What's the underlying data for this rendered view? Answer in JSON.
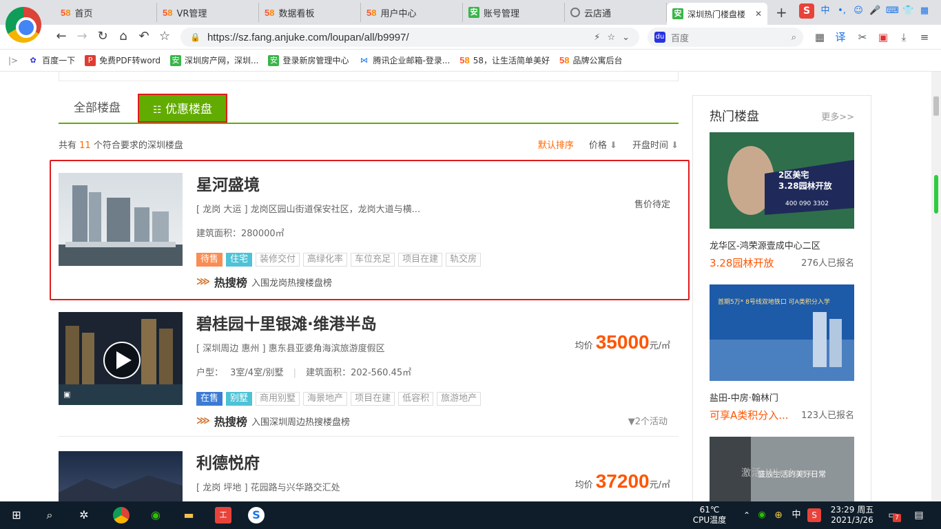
{
  "browser": {
    "tabs": [
      {
        "label": "首页",
        "icon": "58-icon"
      },
      {
        "label": "VR管理",
        "icon": "58-icon"
      },
      {
        "label": "数据看板",
        "icon": "58-icon"
      },
      {
        "label": "用户中心",
        "icon": "58-icon"
      },
      {
        "label": "账号管理",
        "icon": "anjuke-icon"
      },
      {
        "label": "云店通",
        "icon": "globe-icon"
      },
      {
        "label": "深圳热门楼盘楼",
        "icon": "anjuke-icon"
      }
    ],
    "url": "https://sz.fang.anjuke.com/loupan/all/b9997/",
    "search_placeholder": "百度",
    "bookmarks": [
      "百度一下",
      "免费PDF转word",
      "深圳房产网，深圳...",
      "登录新房管理中心",
      "腾讯企业邮箱-登录...",
      "58，让生活简单美好",
      "品牌公寓后台"
    ]
  },
  "page": {
    "tabs": {
      "all": "全部楼盘",
      "promo": "优惠楼盘"
    },
    "result": {
      "prefix": "共有",
      "count": "11",
      "suffix": "个符合要求的深圳楼盘"
    },
    "sorts": {
      "default": "默认排序",
      "price": "价格",
      "open_time": "开盘时间"
    },
    "listings": [
      {
        "name": "星河盛境",
        "address": "[ 龙岗 大运 ] 龙岗区园山街道保安社区，龙岗大道与横...",
        "attr": "建筑面积：280000㎡",
        "price_text": "售价待定",
        "tags": [
          "待售",
          "住宅",
          "装修交付",
          "高绿化率",
          "车位充足",
          "项目在建",
          "轨交房"
        ],
        "hot_label": "热搜榜",
        "hot_text": "入围龙岗热搜楼盘榜"
      },
      {
        "name": "碧桂园十里银滩·维港半岛",
        "address": "[ 深圳周边 惠州 ] 惠东县亚婆角海滨旅游度假区",
        "attr_layout_label": "户型：",
        "attr_layout": "3室/4室/别墅",
        "attr_area": "建筑面积：202-560.45㎡",
        "price_prefix": "均价",
        "price": "35000",
        "price_unit": "元/㎡",
        "tags": [
          "在售",
          "别墅",
          "商用别墅",
          "海景地产",
          "项目在建",
          "低容积",
          "旅游地产"
        ],
        "hot_label": "热搜榜",
        "hot_text": "入围深圳周边热搜楼盘榜",
        "activities": "2个活动"
      },
      {
        "name": "利德悦府",
        "address": "[ 龙岗 坪地 ] 花园路与兴华路交汇处",
        "price_prefix": "均价",
        "price": "37200",
        "price_unit": "元/㎡"
      }
    ]
  },
  "sidebar": {
    "title": "热门楼盘",
    "more": "更多>>",
    "items": [
      {
        "name": "龙华区-鸿荣源壹成中心二区",
        "promo": "3.28园林开放",
        "count": "276人已报名",
        "ad_line1": "2区美宅",
        "ad_line2": "3.28园林开放",
        "ad_phone": "400 090 3302"
      },
      {
        "name": "盐田-中房·翰林门",
        "promo": "可享A类积分入...",
        "count": "123人已报名",
        "ad_line1": "首期5万* 8号线双地铁口 可A类积分入学"
      },
      {
        "ad_line1": "盛放生活的美好日常"
      }
    ]
  },
  "watermark": "激活 Windows",
  "taskbar": {
    "temp": "61℃",
    "temp_label": "CPU温度",
    "ime": "中",
    "time": "23:29 周五",
    "date": "2021/3/26",
    "notif_count": "7"
  }
}
